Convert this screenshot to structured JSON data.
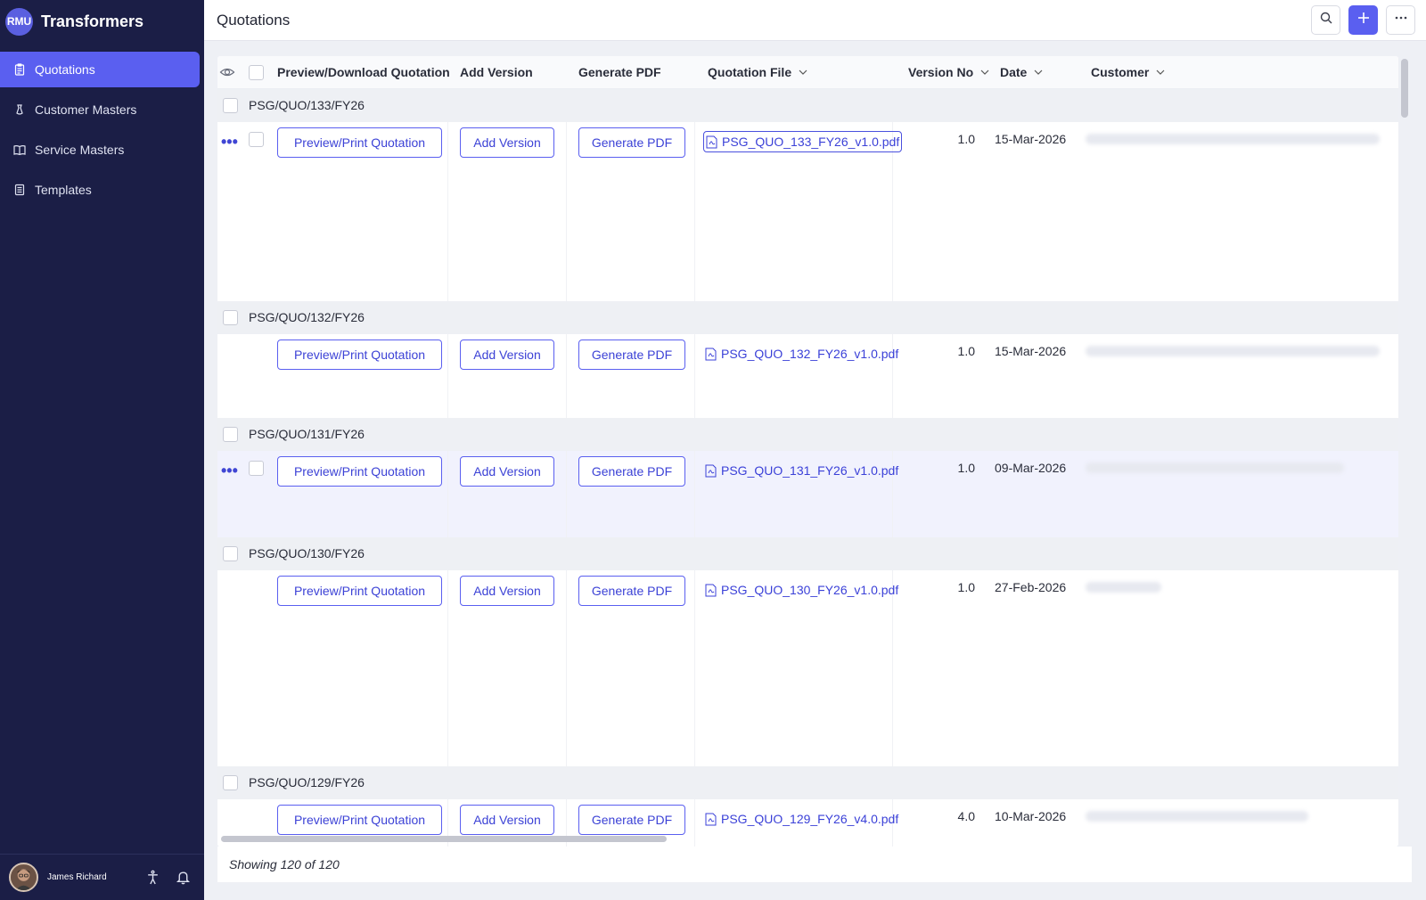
{
  "brand": {
    "logo": "RMU",
    "name": "Transformers"
  },
  "nav": [
    {
      "label": "Quotations",
      "icon": "clipboard-icon",
      "active": true
    },
    {
      "label": "Customer Masters",
      "icon": "user-icon",
      "active": false
    },
    {
      "label": "Service Masters",
      "icon": "book-icon",
      "active": false
    },
    {
      "label": "Templates",
      "icon": "template-icon",
      "active": false
    }
  ],
  "user": {
    "name": "James Richard"
  },
  "header": {
    "title": "Quotations"
  },
  "table": {
    "columns": [
      "Preview/Download Quotation",
      "Add Version",
      "Generate PDF",
      "Quotation File",
      "Version No",
      "Date",
      "Customer"
    ],
    "button_labels": {
      "preview": "Preview/Print Quotation",
      "add_version": "Add Version",
      "generate_pdf": "Generate PDF"
    },
    "groups": [
      {
        "title": "PSG/QUO/133/FY26",
        "file": "PSG_QUO_133_FY26_v1.0.pdf",
        "version": "1.0",
        "date": "15-Mar-2026"
      },
      {
        "title": "PSG/QUO/132/FY26",
        "file": "PSG_QUO_132_FY26_v1.0.pdf",
        "version": "1.0",
        "date": "15-Mar-2026"
      },
      {
        "title": "PSG/QUO/131/FY26",
        "file": "PSG_QUO_131_FY26_v1.0.pdf",
        "version": "1.0",
        "date": "09-Mar-2026"
      },
      {
        "title": "PSG/QUO/130/FY26",
        "file": "PSG_QUO_130_FY26_v1.0.pdf",
        "version": "1.0",
        "date": "27-Feb-2026"
      },
      {
        "title": "PSG/QUO/129/FY26",
        "file": "PSG_QUO_129_FY26_v4.0.pdf",
        "version": "4.0",
        "date": "10-Mar-2026"
      }
    ]
  },
  "footer": {
    "showing": "Showing 120 of 120"
  },
  "colors": {
    "sidebar": "#1b1e46",
    "accent": "#5a5ff0",
    "link": "#3b41d8"
  }
}
